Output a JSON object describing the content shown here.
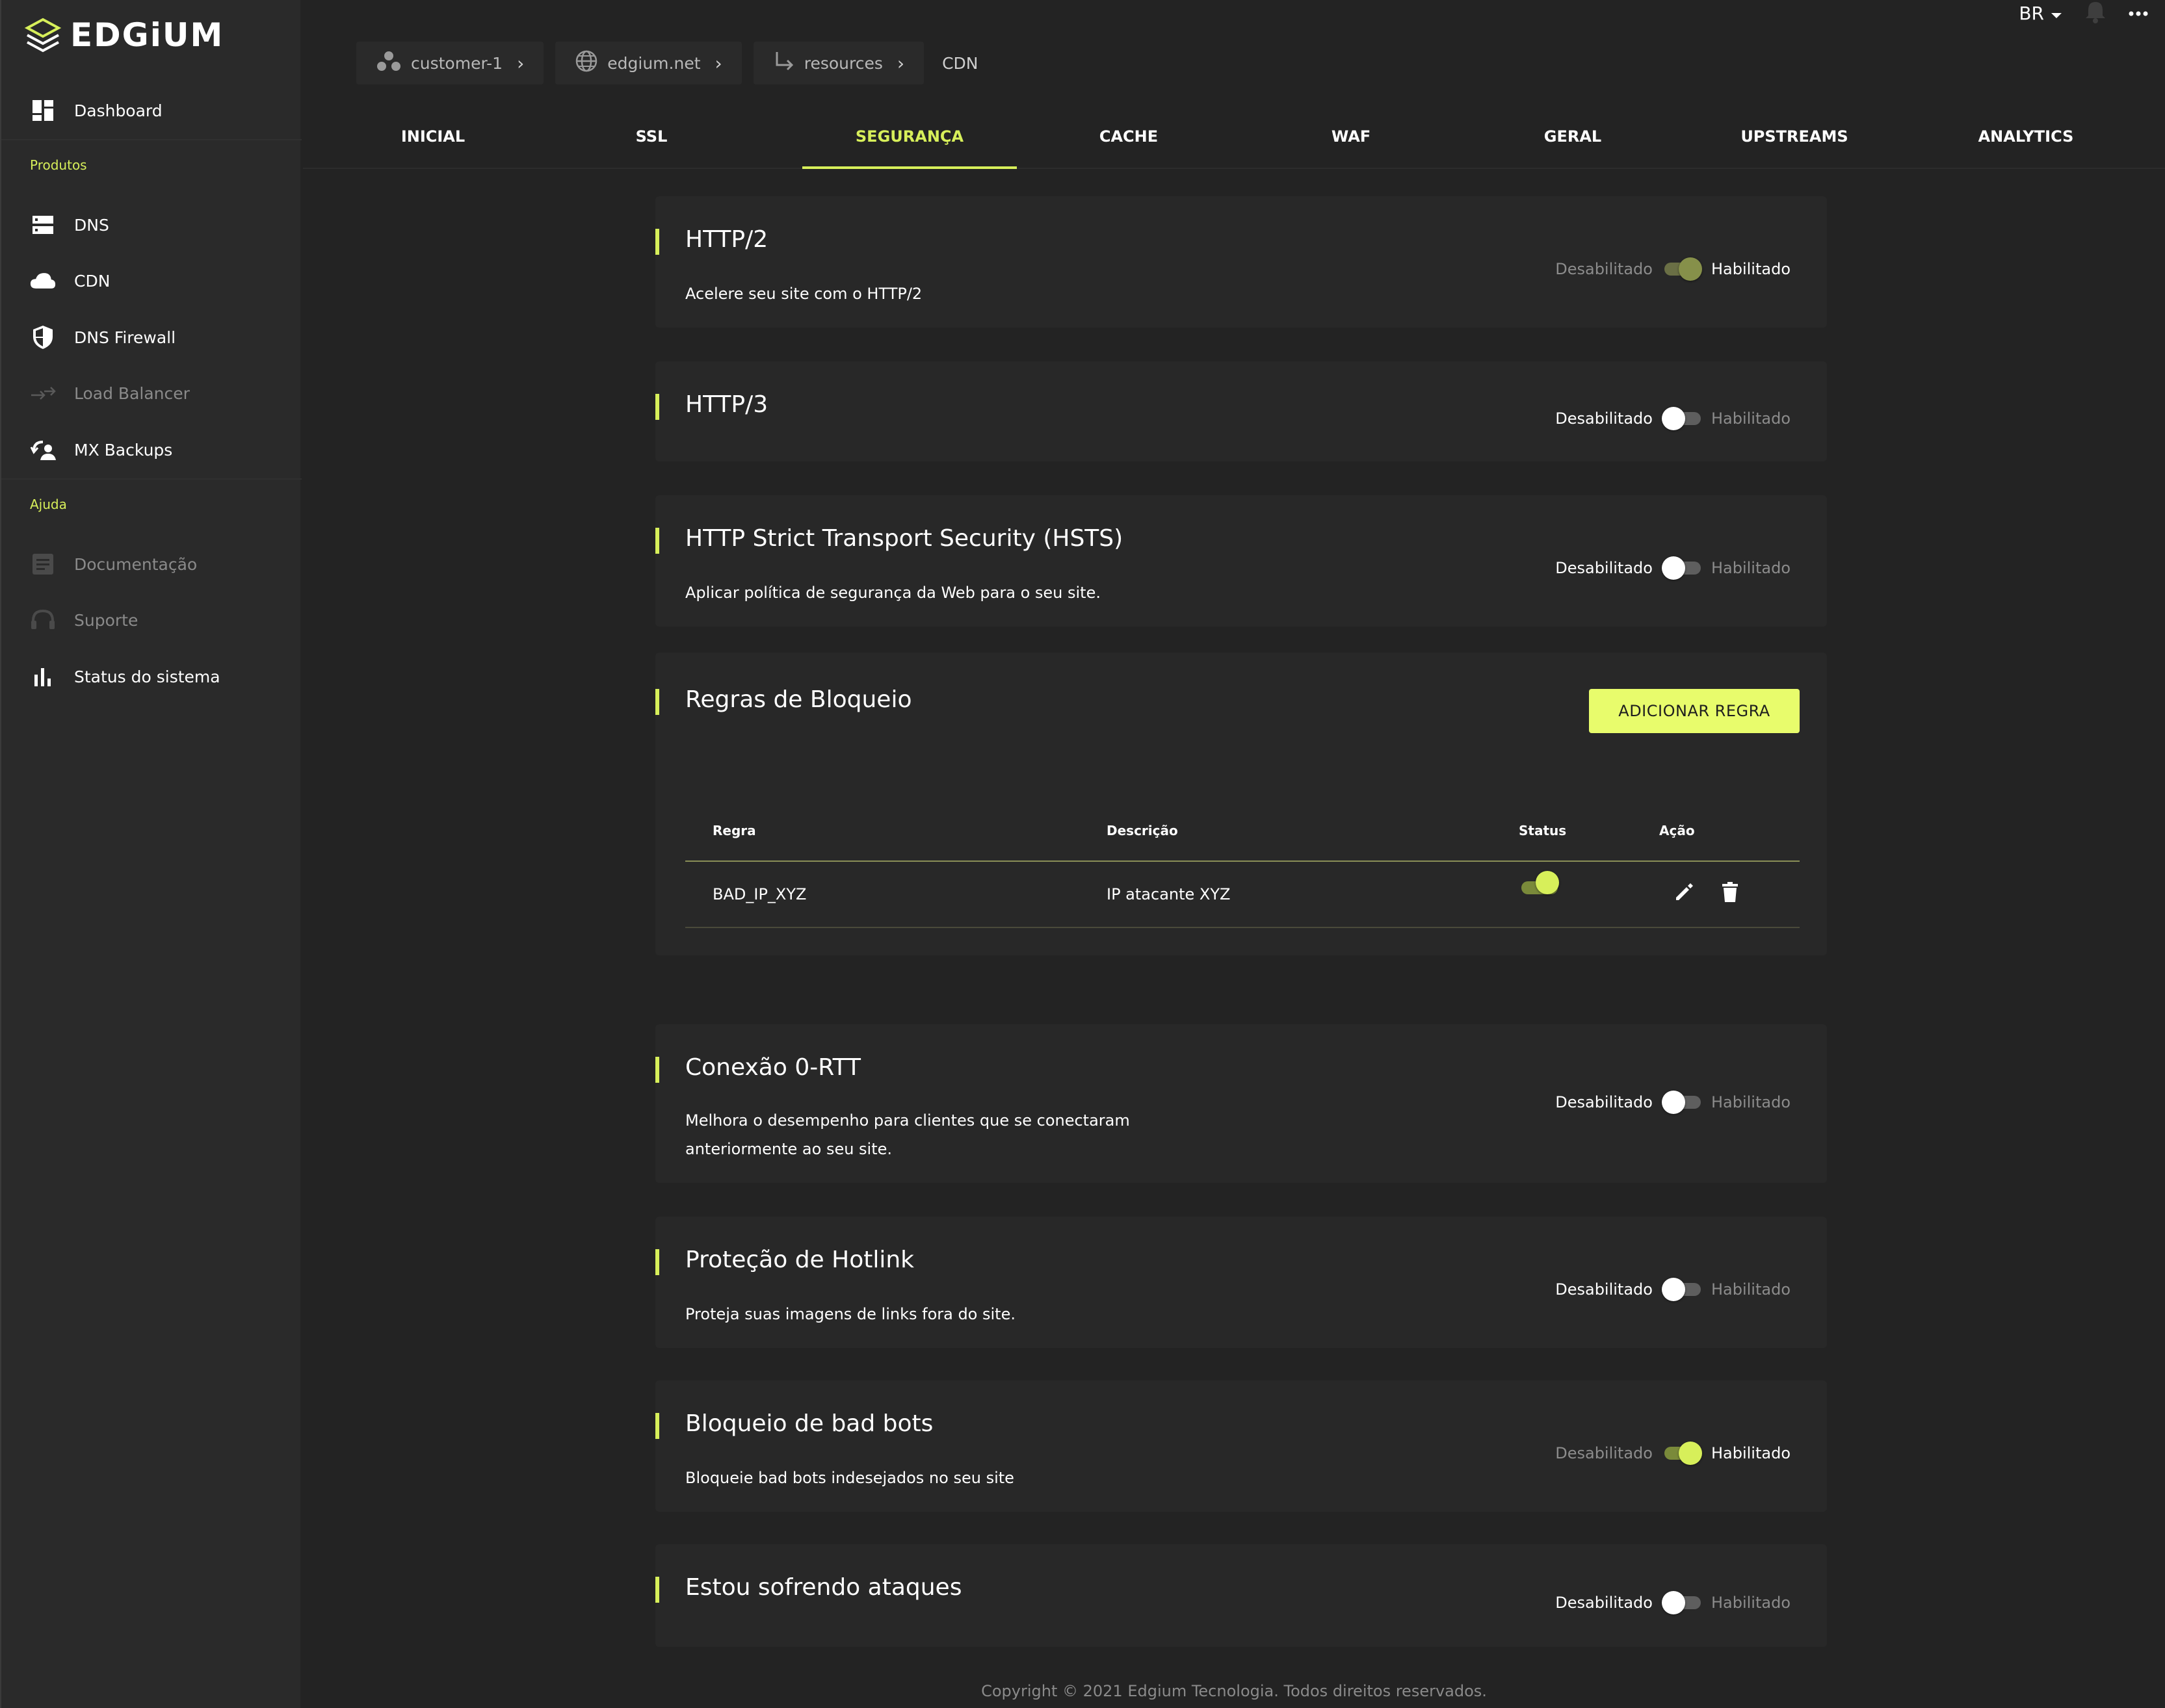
{
  "brand": {
    "name": "EDGiUM",
    "accent": "#d7ef5a"
  },
  "sidebar": {
    "items": [
      {
        "label": "Dashboard",
        "icon": "dashboard-icon"
      },
      {
        "label": "DNS",
        "icon": "dns-icon"
      },
      {
        "label": "CDN",
        "icon": "cloud-icon"
      },
      {
        "label": "DNS Firewall",
        "icon": "shield-icon"
      },
      {
        "label": "Load Balancer",
        "icon": "load-balancer-icon"
      },
      {
        "label": "MX Backups",
        "icon": "mx-backup-icon"
      },
      {
        "label": "Documentação",
        "icon": "document-icon"
      },
      {
        "label": "Suporte",
        "icon": "support-icon"
      },
      {
        "label": "Status do sistema",
        "icon": "bar-chart-icon"
      }
    ],
    "sections": {
      "products": "Produtos",
      "help": "Ajuda"
    }
  },
  "header": {
    "language": "BR",
    "breadcrumb": [
      "customer-1",
      "edgium.net",
      "resources",
      "CDN"
    ]
  },
  "tabs": [
    "INICIAL",
    "SSL",
    "SEGURANÇA",
    "CACHE",
    "WAF",
    "GERAL",
    "UPSTREAMS",
    "ANALYTICS"
  ],
  "active_tab": "SEGURANÇA",
  "toggle_labels": {
    "off": "Desabilitado",
    "on": "Habilitado"
  },
  "settings": [
    {
      "title": "HTTP/2",
      "description": "Acelere seu site com o HTTP/2",
      "enabled": true
    },
    {
      "title": "HTTP/3",
      "description": "",
      "enabled": false
    },
    {
      "title": "HTTP Strict Transport Security (HSTS)",
      "description": "Aplicar política de segurança da Web para o seu site.",
      "enabled": false
    },
    {
      "title": "Conexão 0-RTT",
      "description": "Melhora o desempenho para clientes que se conectaram anteriormente ao seu site.",
      "enabled": false
    },
    {
      "title": "Proteção de Hotlink",
      "description": "Proteja suas imagens de links fora do site.",
      "enabled": false
    },
    {
      "title": "Bloqueio de bad bots",
      "description": "Bloqueie bad bots indesejados no seu site",
      "enabled": true
    },
    {
      "title": "Estou sofrendo ataques",
      "description": "",
      "enabled": false
    }
  ],
  "block_rules": {
    "title": "Regras de Bloqueio",
    "add_button": "ADICIONAR REGRA",
    "columns": [
      "Regra",
      "Descrição",
      "Status",
      "Ação"
    ],
    "rows": [
      {
        "rule": "BAD_IP_XYZ",
        "description": "IP atacante XYZ",
        "status": true
      }
    ]
  },
  "footer": "Copyright © 2021 Edgium Tecnologia. Todos direitos reservados."
}
